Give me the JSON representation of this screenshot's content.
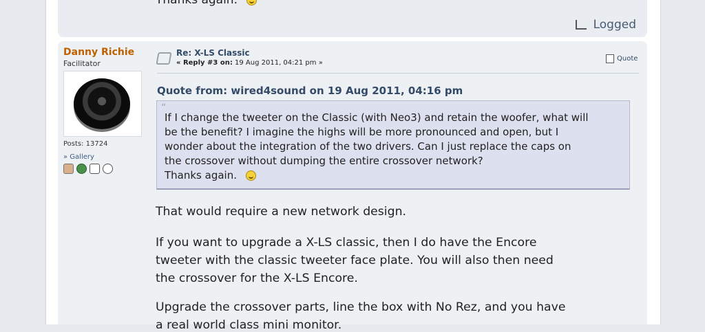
{
  "prev_post": {
    "text": "Thanks again.",
    "logged": "Logged"
  },
  "author": {
    "name": "Danny Richie",
    "role": "Facilitator",
    "posts": "Posts: 13724",
    "gallery": "» Gallery"
  },
  "post": {
    "subject": "Re: X-LS Classic",
    "reply_prefix": "« Reply #3 on:",
    "date": "19 Aug 2011, 04:21 pm »",
    "quote_button": "Quote"
  },
  "quote": {
    "header": "Quote from: wired4sound on 19 Aug 2011, 04:16 pm",
    "lines": [
      "If I change the tweeter on the Classic (with Neo3) and retain the woofer, what will",
      "be the benefit? I imagine the highs will be more pronounced and open, but I",
      "wonder about the integration of the two drivers. Can I just replace the caps on",
      "the crossover without dumping the entire crossover network?",
      "Thanks again."
    ]
  },
  "body": {
    "lines": [
      "That would require a new network design.",
      "If you want to upgrade a X-LS classic, then I do have the Encore",
      "tweeter with the classic tweeter face plate. You will also then need",
      "the crossover for the X-LS Encore.",
      "Upgrade the crossover parts, line the box with No Rez, and you have",
      "a real world class mini monitor."
    ]
  },
  "icons": [
    "smiley-icon",
    "logged-icon",
    "message-icon",
    "quote-icon",
    "profile-icon",
    "website-icon",
    "email-icon",
    "pm-icon"
  ]
}
